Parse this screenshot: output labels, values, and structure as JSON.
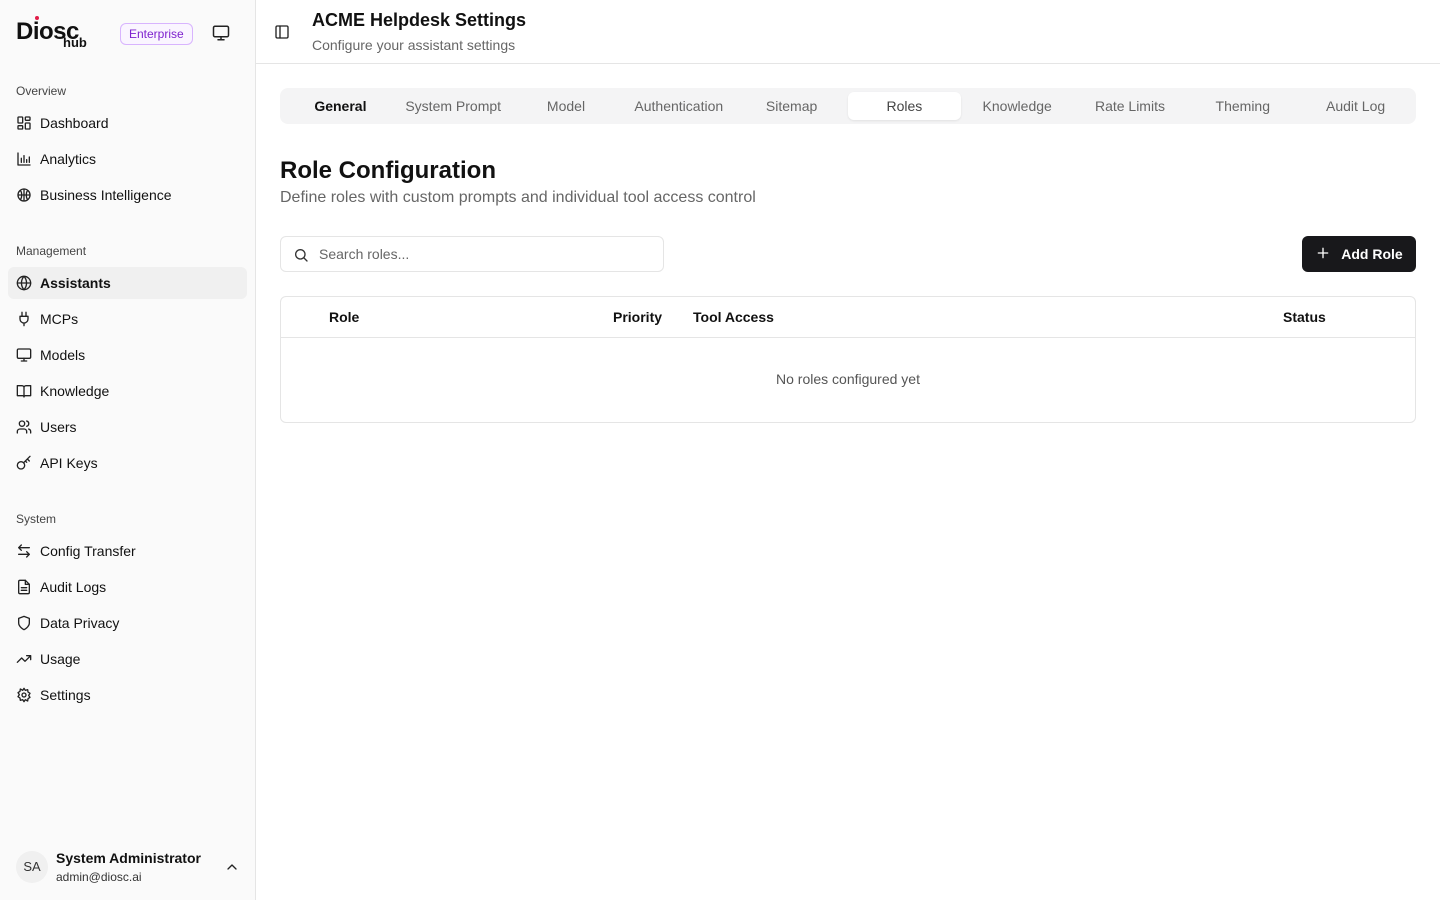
{
  "brand": {
    "logo_main": "Diosc",
    "logo_sub": "hub",
    "plan_badge": "Enterprise"
  },
  "sidebar": {
    "sections": [
      {
        "title": "Overview",
        "items": [
          {
            "label": "Dashboard",
            "icon": "dashboard-icon"
          },
          {
            "label": "Analytics",
            "icon": "bar-chart-icon"
          },
          {
            "label": "Business Intelligence",
            "icon": "brain-icon"
          }
        ]
      },
      {
        "title": "Management",
        "items": [
          {
            "label": "Assistants",
            "icon": "globe-icon",
            "active": true
          },
          {
            "label": "MCPs",
            "icon": "plug-icon"
          },
          {
            "label": "Models",
            "icon": "monitor-icon"
          },
          {
            "label": "Knowledge",
            "icon": "book-icon"
          },
          {
            "label": "Users",
            "icon": "users-icon"
          },
          {
            "label": "API Keys",
            "icon": "key-icon"
          }
        ]
      },
      {
        "title": "System",
        "items": [
          {
            "label": "Config Transfer",
            "icon": "transfer-icon"
          },
          {
            "label": "Audit Logs",
            "icon": "file-icon"
          },
          {
            "label": "Data Privacy",
            "icon": "shield-icon"
          },
          {
            "label": "Usage",
            "icon": "trend-icon"
          },
          {
            "label": "Settings",
            "icon": "gear-icon"
          }
        ]
      }
    ]
  },
  "user": {
    "initials": "SA",
    "name": "System Administrator",
    "email": "admin@diosc.ai"
  },
  "header": {
    "title": "ACME Helpdesk Settings",
    "subtitle": "Configure your assistant settings"
  },
  "tabs": [
    {
      "label": "General"
    },
    {
      "label": "System Prompt"
    },
    {
      "label": "Model"
    },
    {
      "label": "Authentication"
    },
    {
      "label": "Sitemap"
    },
    {
      "label": "Roles",
      "active": true
    },
    {
      "label": "Knowledge"
    },
    {
      "label": "Rate Limits"
    },
    {
      "label": "Theming"
    },
    {
      "label": "Audit Log"
    }
  ],
  "roles": {
    "title": "Role Configuration",
    "description": "Define roles with custom prompts and individual tool access control",
    "search_placeholder": "Search roles...",
    "search_value": "",
    "add_label": "Add Role",
    "columns": {
      "role": "Role",
      "priority": "Priority",
      "tool_access": "Tool Access",
      "status": "Status"
    },
    "empty_message": "No roles configured yet"
  }
}
